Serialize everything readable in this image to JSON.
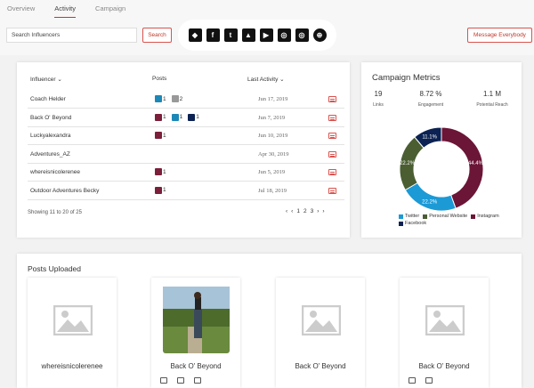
{
  "tabs": [
    {
      "label": "Overview",
      "active": false
    },
    {
      "label": "Activity",
      "active": true
    },
    {
      "label": "Campaign",
      "active": false
    }
  ],
  "search": {
    "placeholder": "Search Influencers",
    "button": "Search"
  },
  "platforms": [
    "diamond-icon",
    "facebook-icon",
    "twitter-icon",
    "strava-icon",
    "youtube-icon",
    "instagram-icon",
    "instagram-alt-icon",
    "globe-icon"
  ],
  "message_button": "Message Everybody",
  "activity": {
    "headers": {
      "influencer": "Influencer",
      "posts": "Posts",
      "last_activity": "Last Activity"
    },
    "rows": [
      {
        "name": "Coach Helder",
        "date": "Jun 17, 2019",
        "posts": [
          {
            "type": "tw",
            "count": "1"
          },
          {
            "type": "ws",
            "count": "2"
          }
        ]
      },
      {
        "name": "Back O' Beyond",
        "date": "Jun 7, 2019",
        "posts": [
          {
            "type": "ig",
            "count": "1"
          },
          {
            "type": "tw",
            "count": "1"
          },
          {
            "type": "fb",
            "count": "1"
          }
        ]
      },
      {
        "name": "Luckyalexandra",
        "date": "Jun 10, 2019",
        "posts": [
          {
            "type": "ig",
            "count": "1"
          }
        ]
      },
      {
        "name": "Adventures_AZ",
        "date": "Apr 30, 2019",
        "posts": []
      },
      {
        "name": "whereisnicolerenee",
        "date": "Jun 5, 2019",
        "posts": [
          {
            "type": "ig",
            "count": "1"
          }
        ]
      },
      {
        "name": "Outdoor Adventures Becky",
        "date": "Jul 18, 2019",
        "posts": [
          {
            "type": "ig",
            "count": "1"
          }
        ]
      }
    ],
    "showing": "Showing 11 to 20 of 25",
    "pages": [
      "1",
      "2",
      "3"
    ]
  },
  "metrics": {
    "title": "Campaign Metrics",
    "stats": [
      {
        "value": "19",
        "label": "Links"
      },
      {
        "value": "8.72 %",
        "label": "Engagement"
      },
      {
        "value": "1.1 M",
        "label": "Potential Reach"
      }
    ]
  },
  "chart_data": {
    "type": "pie",
    "donut": true,
    "categories": [
      "Instagram",
      "Twitter",
      "Personal Website",
      "Facebook"
    ],
    "values": [
      44.4,
      22.2,
      22.2,
      11.1
    ],
    "labels": [
      "44.4%",
      "22.2%",
      "22.2%",
      "11.1%"
    ],
    "colors": [
      "#6b1537",
      "#1b9ad6",
      "#4a5e32",
      "#0b2252"
    ],
    "legend": [
      {
        "name": "Twitter",
        "color": "#1b9ad6"
      },
      {
        "name": "Personal Website",
        "color": "#4a5e32"
      },
      {
        "name": "Instagram",
        "color": "#6b1537"
      },
      {
        "name": "Facebook",
        "color": "#0b2252"
      }
    ],
    "legend_position": "bottom"
  },
  "posts_section": {
    "title": "Posts Uploaded",
    "items": [
      {
        "name": "whereisnicolerenee",
        "has_photo": false,
        "actions": false
      },
      {
        "name": "Back O' Beyond",
        "has_photo": true,
        "actions": true
      },
      {
        "name": "Back O' Beyond",
        "has_photo": false,
        "actions": false
      },
      {
        "name": "Back O' Beyond",
        "has_photo": false,
        "actions": true
      }
    ]
  }
}
